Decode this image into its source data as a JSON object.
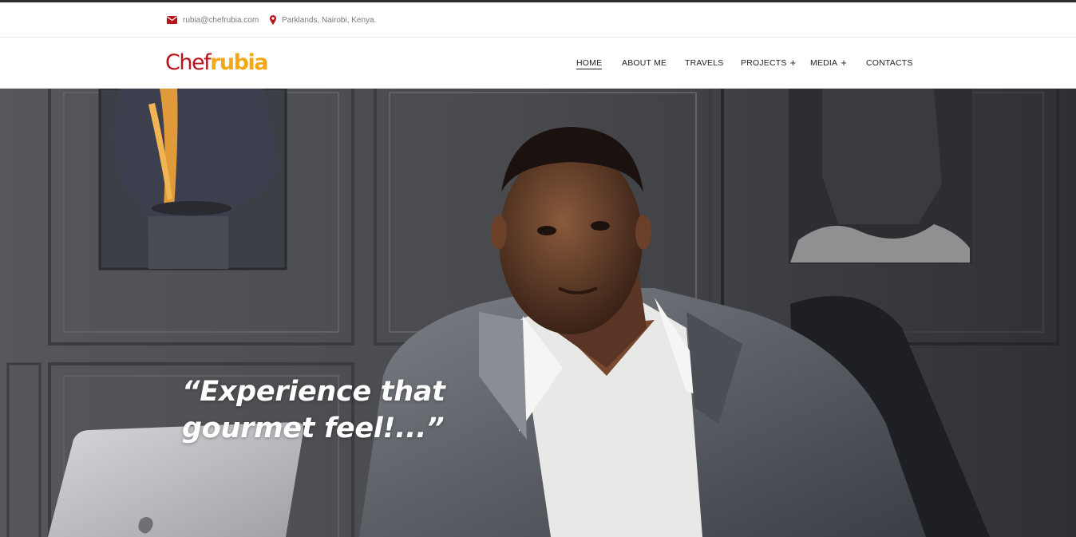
{
  "topbar": {
    "email": "rubia@chefrubia.com",
    "location": "Parklands, Nairobi, Kenya.",
    "email_icon": "envelope-icon",
    "location_icon": "map-marker-icon"
  },
  "logo": {
    "part1": "Chef",
    "part2": "rubia"
  },
  "nav": {
    "home": "HOME",
    "about": "ABOUT ME",
    "travels": "TRAVELS",
    "projects": "PROJECTS",
    "media": "MEDIA",
    "contacts": "CONTACTS",
    "plus": "+"
  },
  "hero": {
    "quote_line1": "“Experience that",
    "quote_line2": "gourmet feel!...”"
  },
  "colors": {
    "brand_red": "#b8141b",
    "brand_yellow": "#f3a916",
    "icon_red": "#b8141b",
    "text_dark": "#222222"
  }
}
